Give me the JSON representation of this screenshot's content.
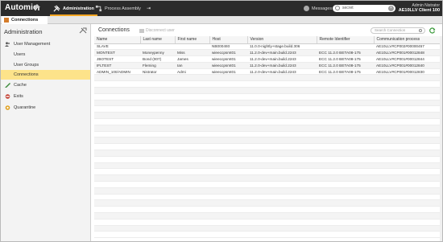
{
  "topbar": {
    "brand": "Automic",
    "tabs": [
      {
        "label": "Administration",
        "active": true
      },
      {
        "label": "Process Assembly",
        "active": false
      }
    ],
    "messages_label": "Messages",
    "search_value": "secret",
    "user_name": "Admin Nistrator",
    "user_client": "AE10LLV Client 100"
  },
  "doc_tab": {
    "label": "Connections"
  },
  "sidebar": {
    "title": "Administration",
    "items": [
      {
        "label": "User Management",
        "icon": "users-icon",
        "level": 0
      },
      {
        "label": "Users",
        "level": 1
      },
      {
        "label": "User Groups",
        "level": 1
      },
      {
        "label": "Connections",
        "level": 1,
        "selected": true
      },
      {
        "label": "Cache",
        "icon": "cache-icon",
        "level": 0
      },
      {
        "label": "Exits",
        "icon": "exits-icon",
        "level": 0
      },
      {
        "label": "Quarantine",
        "icon": "quarantine-icon",
        "level": 0
      }
    ]
  },
  "main": {
    "title": "Connections",
    "disconnect_label": "Disconnect user",
    "search_placeholder": "Search Connection",
    "columns": [
      "Name",
      "Last name",
      "First name",
      "Host",
      "Version",
      "Remote Identifier",
      "Communication process"
    ],
    "rows": [
      [
        "SLAVE",
        "",
        "",
        "NB000493",
        "11.0.0-nightly+stage.build.306",
        "",
        "AE10LLV#CP002#00000457"
      ],
      [
        "MONTEST",
        "Moneypenny",
        "Miss",
        "wieeccpsmt01",
        "11.2.0-dev+main.build.2243",
        "ECC 11.2.0 BETA08-175",
        "AE10LLV#CP001#00012848"
      ],
      [
        "JBOTEST",
        "Bond (007)",
        "James",
        "wieeccpsmt01",
        "11.2.0-dev+main.build.2243",
        "ECC 11.2.0 BETA08-175",
        "AE10LLV#CP001#00012844"
      ],
      [
        "IFLTEST",
        "Fleming",
        "Ian",
        "wieeccpsmt01",
        "11.2.0-dev+main.build.2243",
        "ECC 11.2.0 BETA08-175",
        "AE10LLV#CP001#00012840"
      ],
      [
        "ADMIN_100/ADMIN",
        "Nistrator",
        "Admi",
        "wieeccpsmt01",
        "11.2.0-dev+main.build.2243",
        "ECC 11.2.0 BETA08-175",
        "AE10LLV#CP001#00012830"
      ]
    ]
  },
  "colors": {
    "topbar": "#2b2b2b",
    "accent": "#f5a623",
    "selected": "#fde38a"
  }
}
